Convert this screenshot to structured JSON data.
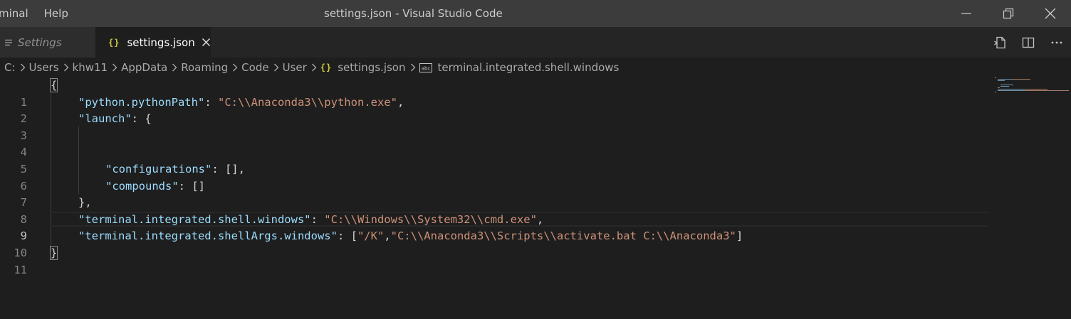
{
  "menu": [
    "minal",
    "Help"
  ],
  "window_title": "settings.json - Visual Studio Code",
  "window_controls": {
    "minimize_icon": "minimize-icon",
    "restore_icon": "restore-icon",
    "close_icon": "close-icon"
  },
  "tabs": [
    {
      "label": "Settings",
      "icon": "settings-list-icon",
      "active": false
    },
    {
      "label": "settings.json",
      "icon": "json-braces-icon",
      "icon_text": "{}",
      "active": true
    }
  ],
  "tab_actions": [
    "open-settings-ui-icon",
    "split-editor-icon",
    "more-actions-icon"
  ],
  "breadcrumb": [
    "C:",
    "Users",
    "khw11",
    "AppData",
    "Roaming",
    "Code",
    "User",
    "settings.json",
    "terminal.integrated.shell.windows"
  ],
  "editor": {
    "active_line": 9,
    "line_numbers": [
      "1",
      "2",
      "3",
      "4",
      "5",
      "6",
      "7",
      "8",
      "9",
      "10",
      "11"
    ],
    "tokens": {
      "l1_open": "{",
      "l2_key": "\"python.pythonPath\"",
      "l2_colon": ": ",
      "l2_val": "\"C:\\\\Anaconda3\\\\python.exe\"",
      "l2_comma": ",",
      "l3_key": "\"launch\"",
      "l3_rest": ": {",
      "l6_key": "\"configurations\"",
      "l6_rest": ": [],",
      "l7_key": "\"compounds\"",
      "l7_rest": ": []",
      "l8_close": "},",
      "l9_key": "\"terminal.integrated.shell.windows\"",
      "l9_colon": ": ",
      "l9_val": "\"C:\\\\Windows\\\\System32\\\\cmd.exe\"",
      "l9_comma": ",",
      "l10_key": "\"terminal.integrated.shellArgs.windows\"",
      "l10_open": ": [",
      "l10_val1": "\"/K\"",
      "l10_sep": ",",
      "l10_val2": "\"C:\\\\Anaconda3\\\\Scripts\\\\activate.bat C:\\\\Anaconda3\"",
      "l10_close": "]",
      "l11_close": "}"
    }
  },
  "colors": {
    "background": "#1e1e1e",
    "titlebar": "#3c3c3c",
    "key": "#9cdcfe",
    "string": "#ce9178",
    "punctuation": "#d4d4d4",
    "json_icon": "#cbcb41"
  }
}
